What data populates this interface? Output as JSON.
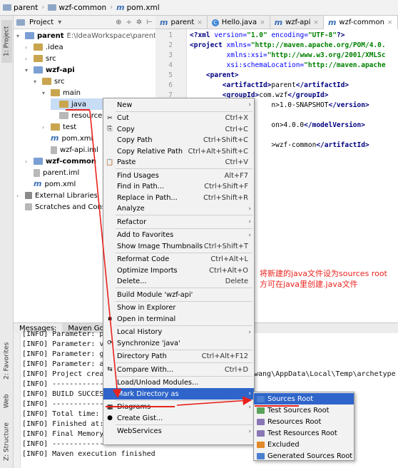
{
  "breadcrumb": {
    "items": [
      "parent",
      "wzf-common",
      "pom.xml"
    ]
  },
  "sidebar": {
    "tabs": [
      "1: Project",
      "2: Favorites",
      "Web",
      "Z: Structure"
    ]
  },
  "project_toolbar": {
    "label": "Project",
    "dropdown": "▾",
    "icons": [
      "⊕",
      "÷",
      "✲",
      "⊢"
    ]
  },
  "tree": {
    "rows": [
      {
        "label": "parent",
        "extra": "E:\\IdeaWorkspace\\parent",
        "icon": "module-folder-icon",
        "arrow": "▾",
        "bold": true
      },
      {
        "label": ".idea",
        "icon": "folder-icon",
        "arrow": "›"
      },
      {
        "label": "src",
        "icon": "folder-icon",
        "arrow": "›"
      },
      {
        "label": "wzf-api",
        "icon": "module-folder-icon",
        "arrow": "▾",
        "bold": true
      },
      {
        "label": "src",
        "icon": "folder-icon",
        "arrow": "▾"
      },
      {
        "label": "main",
        "icon": "folder-icon",
        "arrow": "▾"
      },
      {
        "label": "java",
        "icon": "folder-icon",
        "arrow": ""
      },
      {
        "label": "resources",
        "icon": "resources-folder-icon",
        "arrow": ""
      },
      {
        "label": "test",
        "icon": "folder-icon",
        "arrow": "›"
      },
      {
        "label": "pom.xml",
        "icon": "maven-icon",
        "arrow": ""
      },
      {
        "label": "wzf-api.iml",
        "icon": "iml-file-icon",
        "arrow": ""
      },
      {
        "label": "wzf-common",
        "icon": "module-folder-icon",
        "arrow": "›",
        "bold": true
      },
      {
        "label": "parent.iml",
        "icon": "iml-file-icon",
        "arrow": ""
      },
      {
        "label": "pom.xml",
        "icon": "maven-icon",
        "arrow": ""
      },
      {
        "label": "External Libraries",
        "icon": "libraries-icon",
        "arrow": "›"
      },
      {
        "label": "Scratches and Consoles",
        "icon": "scratches-icon",
        "arrow": ""
      }
    ]
  },
  "editor_tabs": [
    {
      "label": "parent",
      "icon": "m"
    },
    {
      "label": "Hello.java",
      "icon": "C"
    },
    {
      "label": "wzf-api",
      "icon": "m"
    },
    {
      "label": "wzf-common",
      "icon": "m",
      "active": true
    }
  ],
  "editor": {
    "lines": [
      {
        "n": "1",
        "html": "<span class='tag'>&lt;?xml</span> <span class='attr'>version=</span><span class='val'>\"1.0\"</span> <span class='attr'>encoding=</span><span class='val'>\"UTF-8\"</span><span class='tag'>?&gt;</span>"
      },
      {
        "n": "2",
        "html": "<span class='tag'>&lt;project</span> <span class='attr'>xmlns=</span><span class='val'>\"http://maven.apache.org/POM/4.0.</span>"
      },
      {
        "n": "3",
        "html": "         <span class='attr'>xmlns:xsi=</span><span class='val'>\"http://www.w3.org/2001/XMLSc</span>"
      },
      {
        "n": "4",
        "html": "         <span class='attr'>xsi:schemaLocation=</span><span class='val'>\"http://maven.apache</span>"
      },
      {
        "n": "5",
        "html": "    <span class='tag'>&lt;parent&gt;</span>"
      },
      {
        "n": "6",
        "html": "        <span class='tag'>&lt;artifactId&gt;</span>parent<span class='tag'>&lt;/artifactId&gt;</span>"
      },
      {
        "n": "7",
        "html": "        <span class='tag'>&lt;groupId&gt;</span>com.wzf<span class='tag'>&lt;/groupId&gt;</span>"
      },
      {
        "n": "8",
        "html": "                    n&gt;1.0-SNAPSHOT<span class='tag'>&lt;/version&gt;</span>"
      },
      {
        "n": "9",
        "html": ""
      },
      {
        "n": "10",
        "html": "                    on&gt;4.0.0<span class='tag'>&lt;/modelVersion&gt;</span>"
      },
      {
        "n": "11",
        "html": ""
      },
      {
        "n": "12",
        "html": "                    &gt;wzf-common<span class='tag'>&lt;/artifactId&gt;</span>"
      }
    ]
  },
  "bottom_tabs": [
    "Messages:",
    "Maven Goal"
  ],
  "console": {
    "lines": [
      "[INFO] Parameter: p",
      "[INFO] Parameter: v",
      "[INFO] Parameter: g",
      "[INFO] Parameter: a",
      "[INFO] Project crea",
      "[INFO] ------------",
      "[INFO] BUILD SUCCES",
      "[INFO] ------------",
      "[INFO] Total time: ",
      "[INFO] Finished at:",
      "[INFO] Final Memory",
      "[INFO] ------------",
      "[INFO] Maven execution finished"
    ],
    "path_fragment": "wang\\AppData\\Local\\Temp\\archetype"
  },
  "context_menu": {
    "items": [
      {
        "label": "New",
        "sub": true
      },
      {
        "sep": true
      },
      {
        "label": "Cut",
        "shortcut": "Ctrl+X",
        "icon": "✂"
      },
      {
        "label": "Copy",
        "shortcut": "Ctrl+C",
        "icon": "⎘"
      },
      {
        "label": "Copy Path",
        "shortcut": "Ctrl+Shift+C"
      },
      {
        "label": "Copy Relative Path",
        "shortcut": "Ctrl+Alt+Shift+C"
      },
      {
        "label": "Paste",
        "shortcut": "Ctrl+V",
        "icon": "📋"
      },
      {
        "sep": true
      },
      {
        "label": "Find Usages",
        "shortcut": "Alt+F7"
      },
      {
        "label": "Find in Path...",
        "shortcut": "Ctrl+Shift+F"
      },
      {
        "label": "Replace in Path...",
        "shortcut": "Ctrl+Shift+R"
      },
      {
        "label": "Analyze",
        "sub": true
      },
      {
        "sep": true
      },
      {
        "label": "Refactor",
        "sub": true
      },
      {
        "sep": true
      },
      {
        "label": "Add to Favorites",
        "sub": true
      },
      {
        "label": "Show Image Thumbnails",
        "shortcut": "Ctrl+Shift+T"
      },
      {
        "sep": true
      },
      {
        "label": "Reformat Code",
        "shortcut": "Ctrl+Alt+L"
      },
      {
        "label": "Optimize Imports",
        "shortcut": "Ctrl+Alt+O"
      },
      {
        "label": "Delete...",
        "shortcut": "Delete"
      },
      {
        "sep": true
      },
      {
        "label": "Build Module 'wzf-api'"
      },
      {
        "sep": true
      },
      {
        "label": "Show in Explorer"
      },
      {
        "label": "Open in terminal",
        "icon": "▪"
      },
      {
        "sep": true
      },
      {
        "label": "Local History",
        "sub": true
      },
      {
        "label": "Synchronize 'java'",
        "icon": "⟳"
      },
      {
        "sep": true
      },
      {
        "label": "Directory Path",
        "shortcut": "Ctrl+Alt+F12"
      },
      {
        "sep": true
      },
      {
        "label": "Compare With...",
        "shortcut": "Ctrl+D",
        "icon": "⇆"
      },
      {
        "sep": true
      },
      {
        "label": "Load/Unload Modules..."
      },
      {
        "label": "Mark Directory as",
        "sub": true,
        "highlight": true
      },
      {
        "sep": true
      },
      {
        "label": "Diagrams",
        "sub": true,
        "icon": "▦"
      },
      {
        "label": "Create Gist...",
        "icon": "●"
      },
      {
        "sep": true
      },
      {
        "label": "WebServices",
        "sub": true
      }
    ]
  },
  "submenu": {
    "items": [
      {
        "label": "Sources Root",
        "color": "#4a7fd1",
        "highlight": true
      },
      {
        "label": "Test Sources Root",
        "color": "#5aa35a"
      },
      {
        "label": "Resources Root",
        "color": "#8a77b5"
      },
      {
        "label": "Test Resources Root",
        "color": "#8a77b5"
      },
      {
        "label": "Excluded",
        "color": "#e28a2b"
      },
      {
        "label": "Generated Sources Root",
        "color": "#4a7fd1"
      }
    ]
  },
  "annotation": {
    "text_line1": "将新建的java文件设为sources root",
    "text_line2": "方可在java里创建.java文件"
  },
  "colors": {
    "highlight": "#2f65ca",
    "annotation": "#e8231d"
  }
}
